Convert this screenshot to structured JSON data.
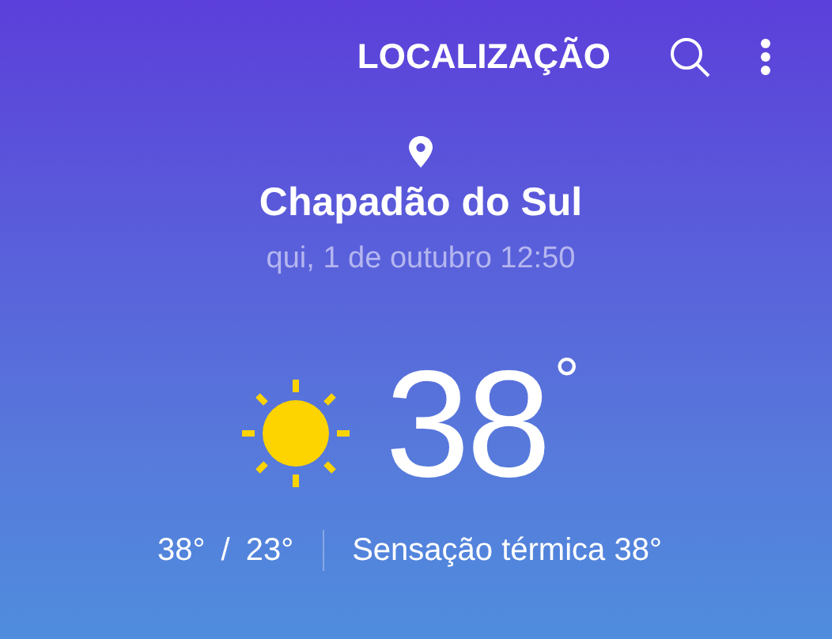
{
  "toolbar": {
    "location_button": "LOCALIZAÇÃO"
  },
  "location": {
    "city": "Chapadão do Sul",
    "datetime": "qui, 1 de outubro 12:50"
  },
  "current": {
    "temperature": "38",
    "unit": "°"
  },
  "summary": {
    "high": "38°",
    "separator": "/",
    "low": "23°",
    "feels_like": "Sensação térmica 38°"
  }
}
